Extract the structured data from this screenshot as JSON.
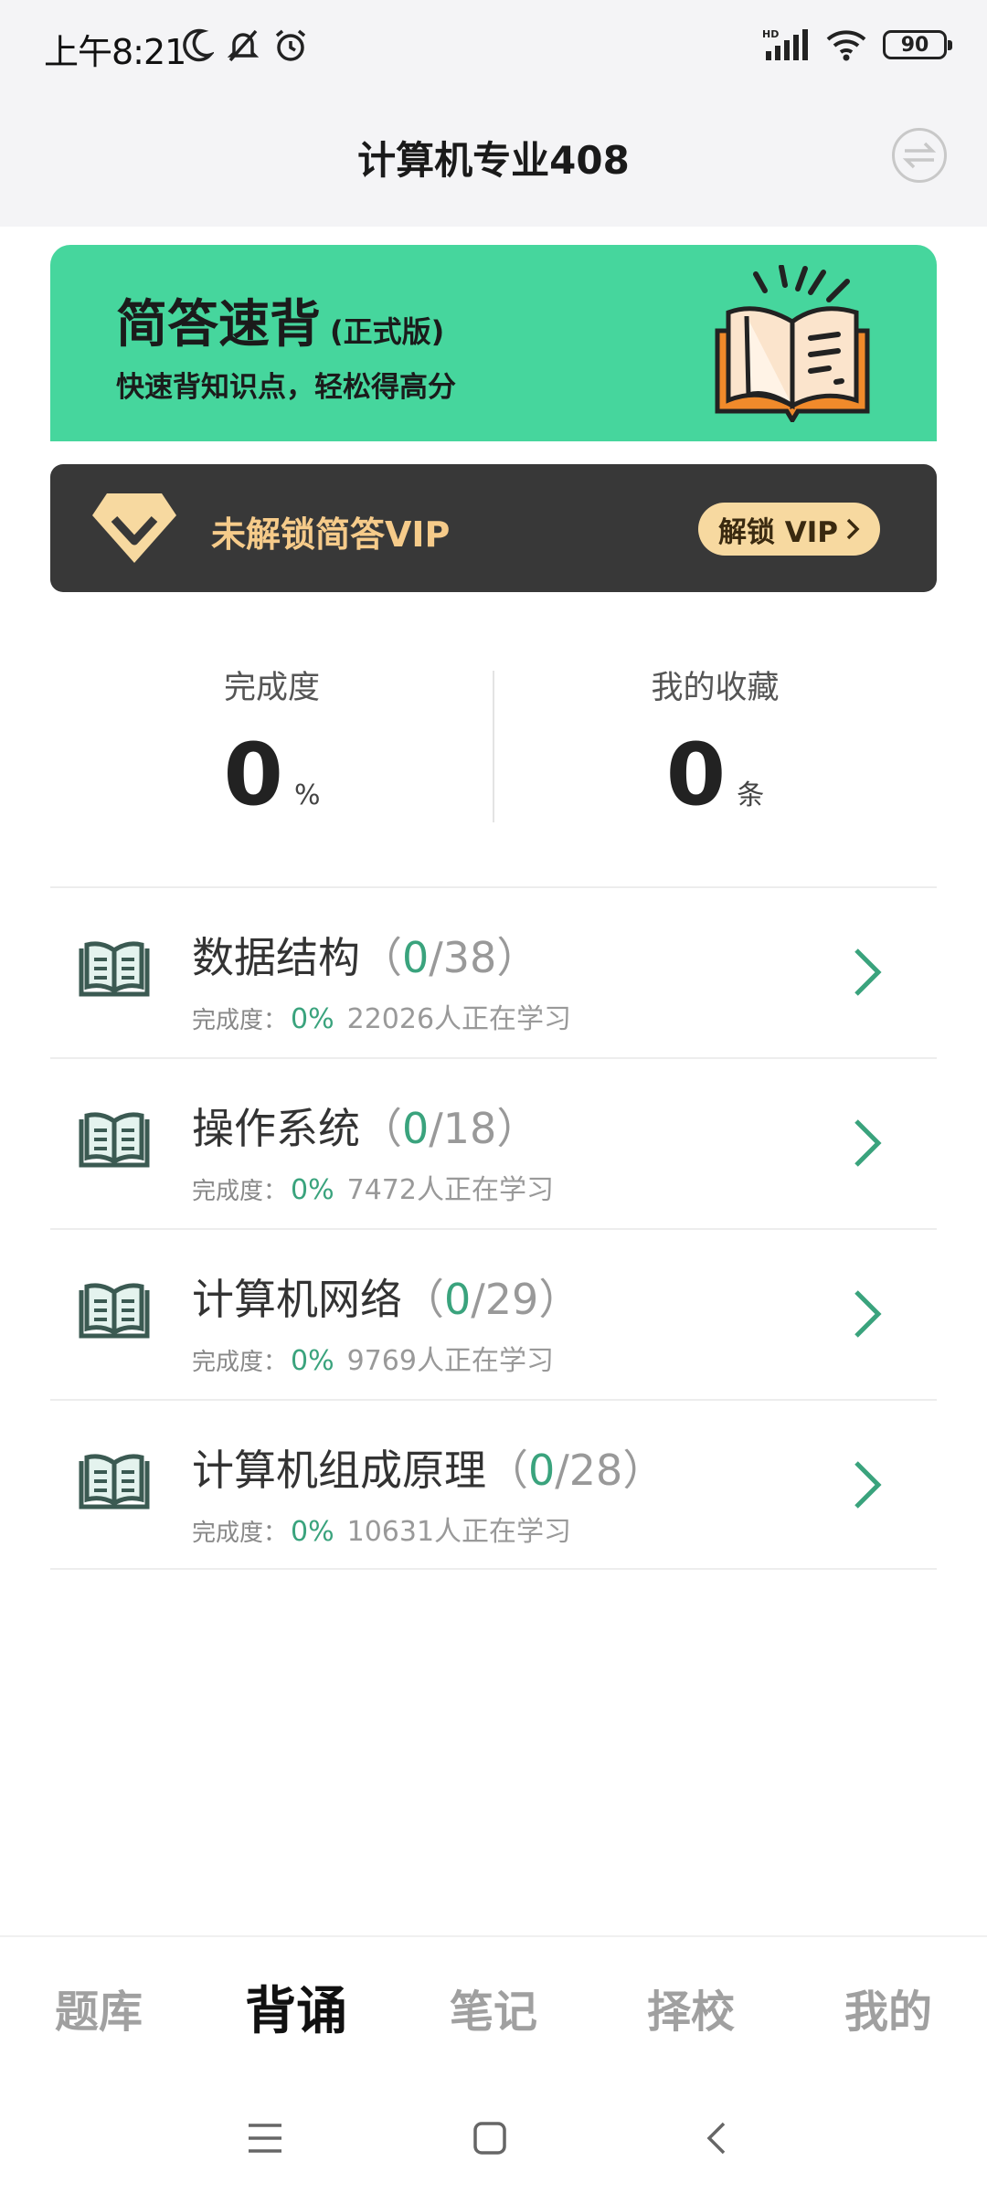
{
  "status_bar": {
    "time": "上午8:21",
    "battery": "90",
    "network": "HD"
  },
  "header": {
    "title": "计算机专业408"
  },
  "banner": {
    "title": "简答速背",
    "edition": "(正式版)",
    "subtitle": "快速背知识点，轻松得高分"
  },
  "vip": {
    "text": "未解锁简答VIP",
    "button": "解锁 VIP"
  },
  "stats": {
    "completion": {
      "label": "完成度",
      "value": "0",
      "unit": "%"
    },
    "favorites": {
      "label": "我的收藏",
      "value": "0",
      "unit": "条"
    }
  },
  "subjects": [
    {
      "name": "数据结构",
      "done": "0",
      "total": "/38",
      "completion_label": "完成度：",
      "percent": "0%",
      "learners": "22026人正在学习"
    },
    {
      "name": "操作系统",
      "done": "0",
      "total": "/18",
      "completion_label": "完成度：",
      "percent": "0%",
      "learners": "7472人正在学习"
    },
    {
      "name": "计算机网络",
      "done": "0",
      "total": "/29",
      "completion_label": "完成度：",
      "percent": "0%",
      "learners": "9769人正在学习"
    },
    {
      "name": "计算机组成原理",
      "done": "0",
      "total": "/28",
      "completion_label": "完成度：",
      "percent": "0%",
      "learners": "10631人正在学习"
    }
  ],
  "tabs": [
    {
      "label": "题库",
      "active": false
    },
    {
      "label": "背诵",
      "active": true
    },
    {
      "label": "笔记",
      "active": false
    },
    {
      "label": "择校",
      "active": false
    },
    {
      "label": "我的",
      "active": false
    }
  ],
  "colors": {
    "accent_green": "#46d69d",
    "progress_green": "#3aa37d",
    "vip_gold": "#f6cb8a",
    "vip_bg": "#383838"
  }
}
